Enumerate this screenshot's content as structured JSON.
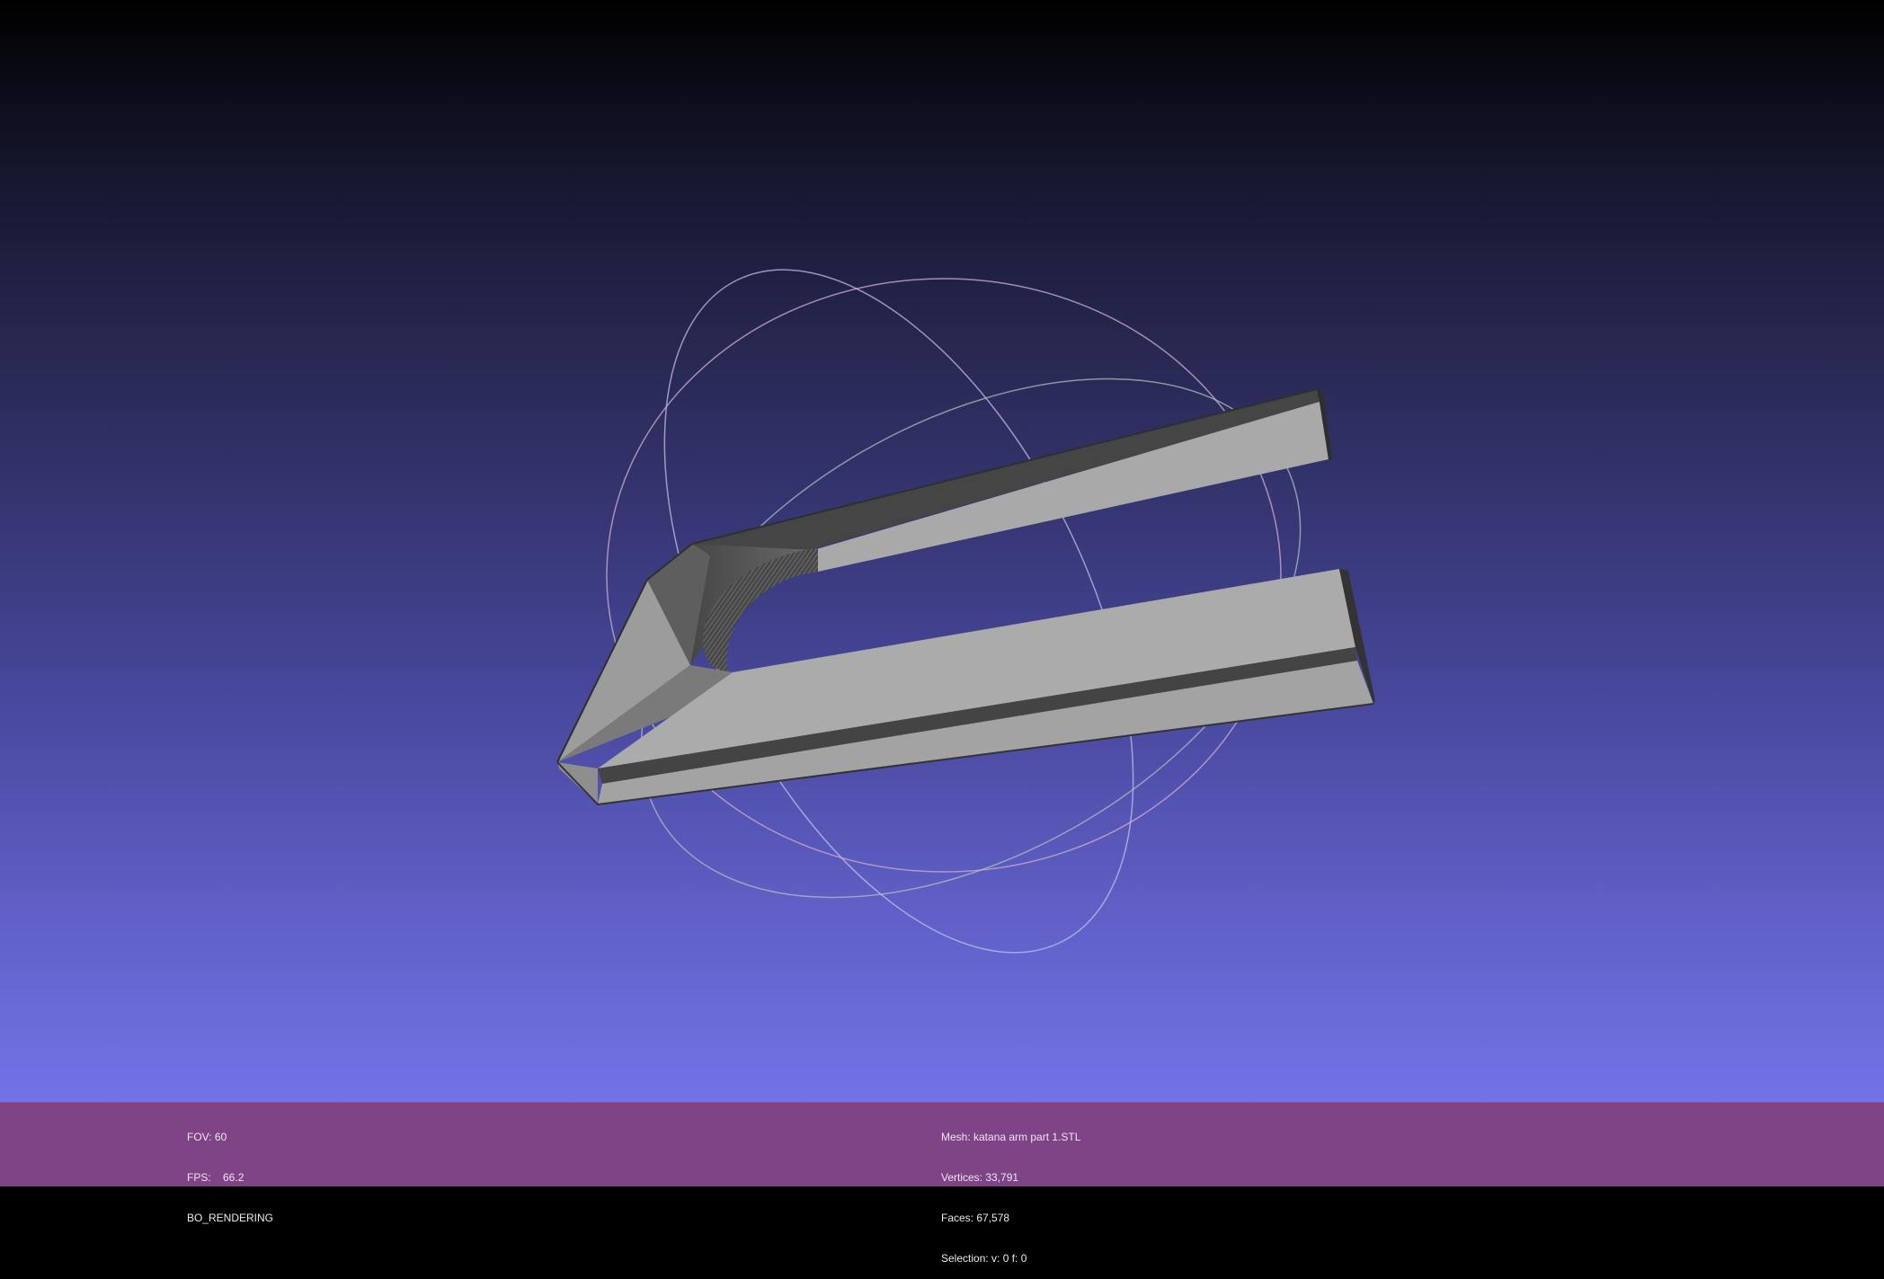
{
  "left_info": {
    "fov": "FOV: 60",
    "fps": "FPS:    66.2",
    "render_mode": "BO_RENDERING"
  },
  "right_info": {
    "mesh": "Mesh: katana arm part 1.STL",
    "vertices": "Vertices: 33,791",
    "faces": "Faces: 67,578",
    "selection": "Selection: v: 0 f: 0"
  },
  "colors": {
    "background_top": "#000000",
    "background_bottom": "#7373e8",
    "info_bar": "#7e4486",
    "mesh_face_light": "#a8a8a8",
    "mesh_edge_dark": "#3a3a3a"
  }
}
